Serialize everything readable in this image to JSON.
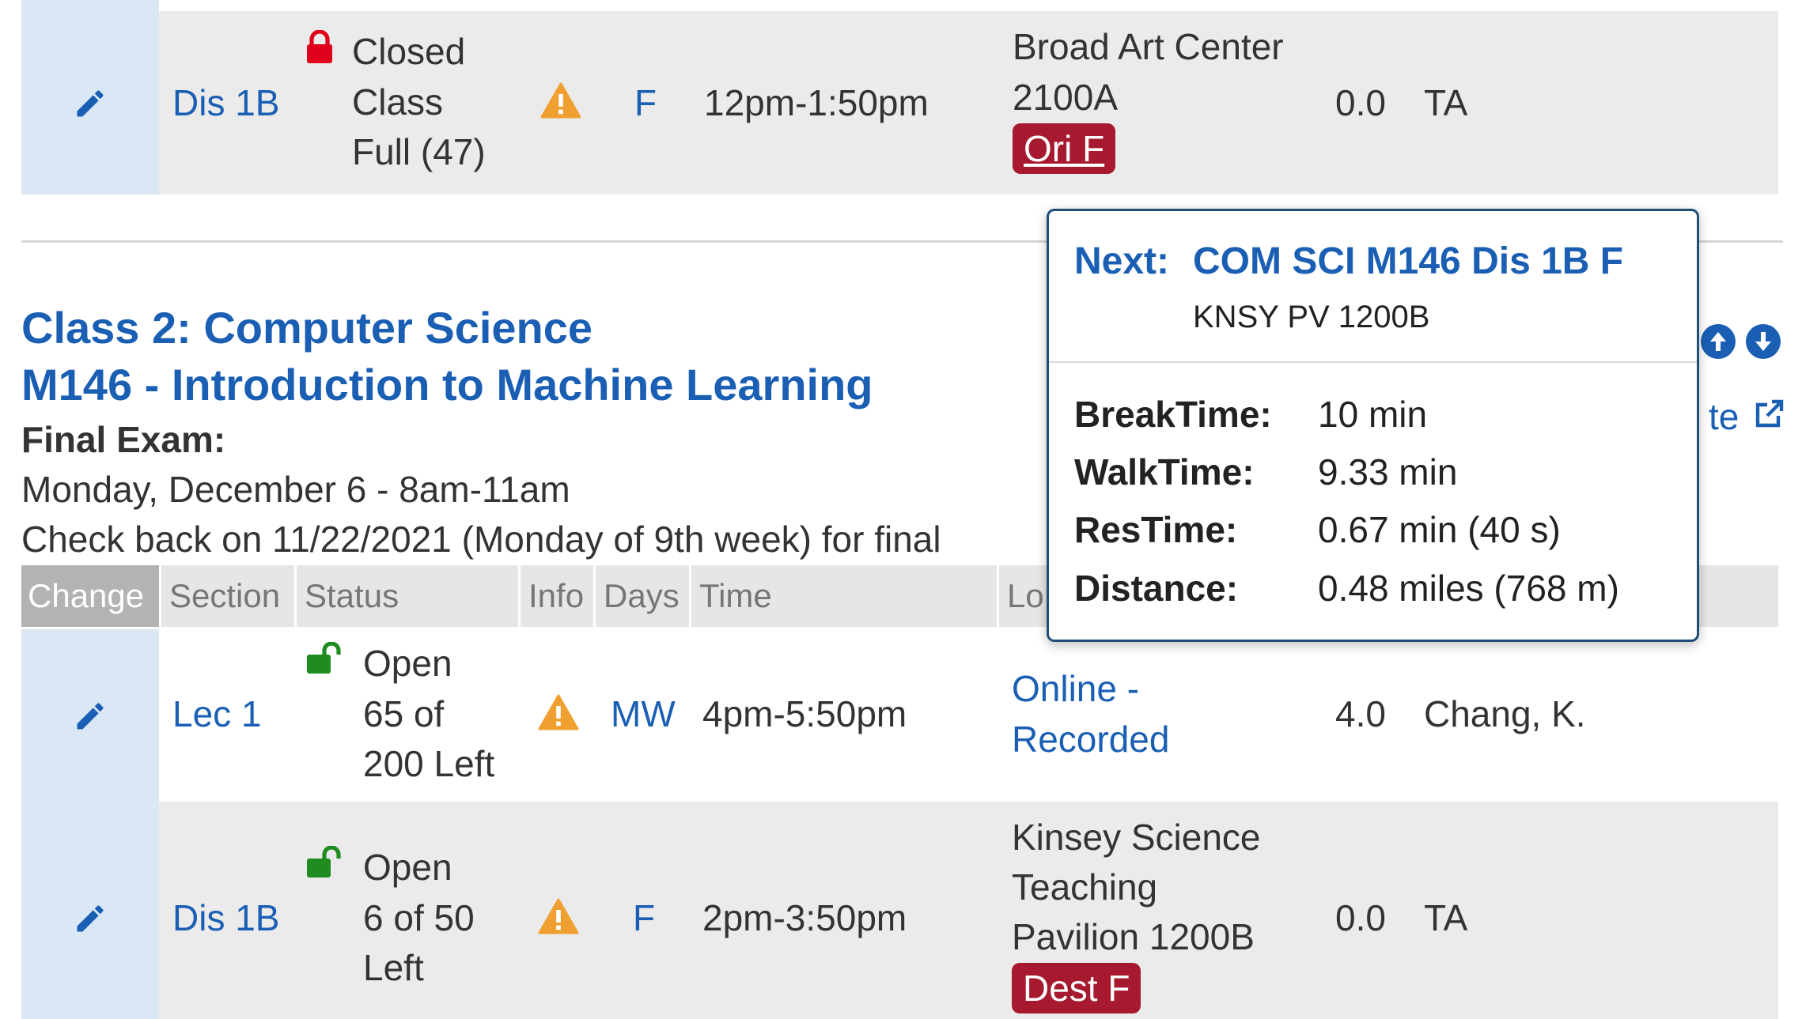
{
  "row_prev": {
    "section": "Dis 1B",
    "status_lines": [
      "Closed",
      "Class",
      "Full (47)"
    ],
    "days": "F",
    "time": "12pm-1:50pm",
    "location_lines": [
      "Broad Art Center",
      "2100A"
    ],
    "location_tag": "Ori F",
    "units": "0.0",
    "instructor": "TA"
  },
  "class_header": {
    "title_line1": "Class 2: Computer Science",
    "title_line2": "M146 - Introduction to Machine Learning",
    "final_label": "Final Exam:",
    "final_date": "Monday, December 6 - 8am-11am",
    "check_back": "Check back on 11/22/2021 (Monday of 9th week) for final",
    "partial_link": "te"
  },
  "table_headers": {
    "change": "Change",
    "section": "Section",
    "status": "Status",
    "info": "Info",
    "days": "Days",
    "time": "Time",
    "location_partial": "Lo"
  },
  "row_lec": {
    "section": "Lec 1",
    "status_lines": [
      "Open",
      "65 of",
      "200 Left"
    ],
    "days": "MW",
    "time": "4pm-5:50pm",
    "location_lines": [
      "Online -",
      "Recorded"
    ],
    "units": "4.0",
    "instructor": "Chang, K."
  },
  "row_dis": {
    "section": "Dis 1B",
    "status_lines": [
      "Open",
      "6 of 50",
      "Left"
    ],
    "days": "F",
    "time": "2pm-3:50pm",
    "location_lines": [
      "Kinsey Science",
      "Teaching",
      "Pavilion 1200B"
    ],
    "location_tag": "Dest F",
    "units": "0.0",
    "instructor": "TA"
  },
  "tooltip": {
    "next_label": "Next:",
    "next_course": "COM SCI M146 Dis 1B F",
    "next_location": "KNSY PV 1200B",
    "break_label": "BreakTime:",
    "break_value": "10 min",
    "walk_label": "WalkTime:",
    "walk_value": "9.33 min",
    "res_label": "ResTime:",
    "res_value": "0.67 min (40 s)",
    "dist_label": "Distance:",
    "dist_value": "0.48 miles (768 m)"
  },
  "icons": {
    "edit": "pencil-icon",
    "closed": "lock-closed-icon",
    "open": "lock-open-icon",
    "warning": "warning-icon",
    "up": "arrow-up-circle-icon",
    "down": "arrow-down-circle-icon",
    "external": "external-link-icon"
  },
  "colors": {
    "link_blue": "#1a5fb4",
    "tag_red": "#a6192e",
    "open_green": "#1e8c1e",
    "closed_red": "#e0001b",
    "warning_orange": "#f0a030",
    "change_cell": "#d9e8f4",
    "row_gray": "#ebebeb"
  }
}
